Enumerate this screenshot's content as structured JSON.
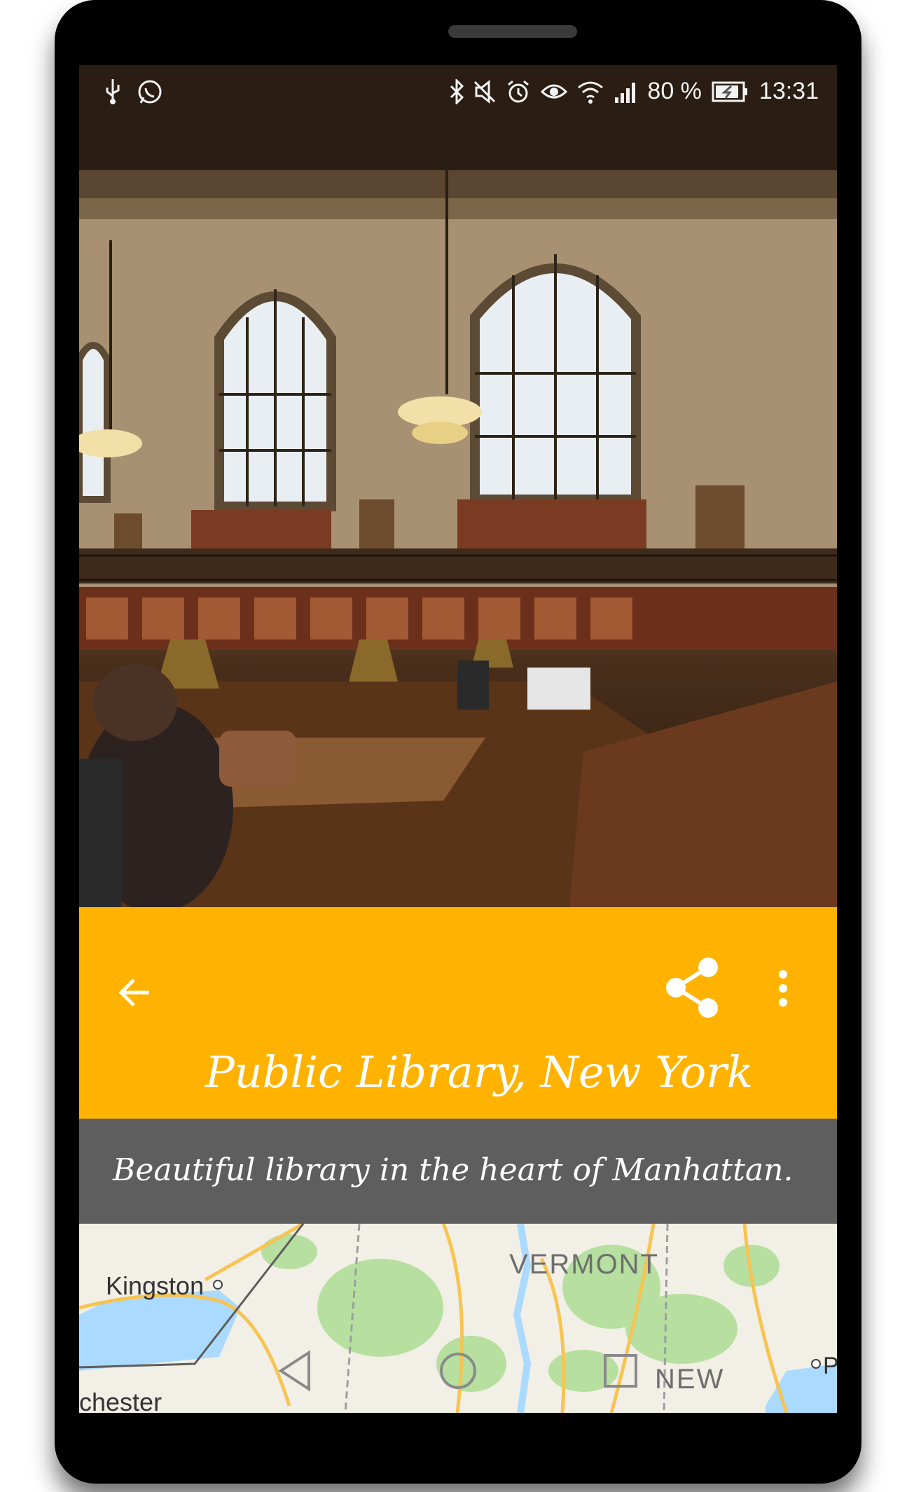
{
  "status_bar": {
    "battery": "80 %",
    "time": "13:31",
    "left_icons": [
      "usb-icon",
      "whatsapp-icon"
    ],
    "right_icons": [
      "bluetooth-icon",
      "mute-icon",
      "alarm-icon",
      "eye-icon",
      "wifi-icon",
      "signal-icon",
      "battery-charging-icon"
    ]
  },
  "toolbar": {
    "title": "Public Library, New York",
    "back_icon": "arrow-back-icon",
    "share_icon": "share-icon",
    "more_icon": "more-vert-icon"
  },
  "description": "Beautiful library in the heart of Manhattan.",
  "map": {
    "labels": [
      "Kingston",
      "VERMONT",
      "NEW",
      "chester",
      "P"
    ]
  },
  "nav_bar": {
    "buttons": [
      "back-triangle-icon",
      "home-circle-icon",
      "recents-square-icon"
    ]
  },
  "colors": {
    "toolbar_bg": "#ffb300",
    "subtitle_bg": "#5e5e5e",
    "text_on_toolbar": "#ffffff"
  }
}
